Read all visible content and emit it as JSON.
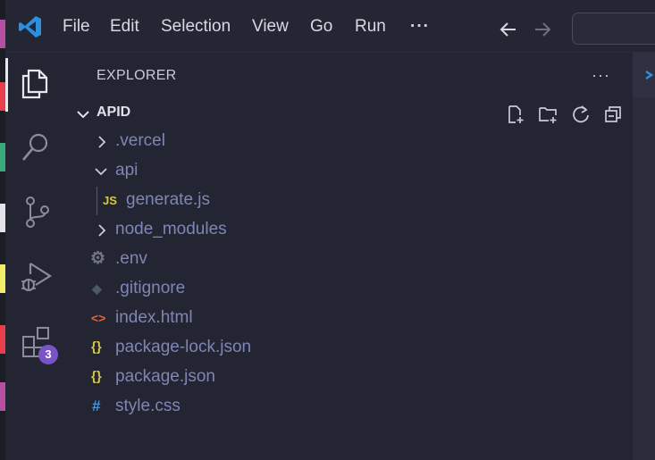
{
  "colors": {
    "background": "#242533",
    "accent_blue": "#2d8fe0",
    "tree_text": "#7f86b3",
    "badge": "#7b53c9",
    "html_icon": "#e0663a",
    "json_icon": "#d6c84b",
    "css_icon": "#4a93d6",
    "js_icon": "#d6c84b",
    "gear_icon": "#6f7486",
    "git_icon": "#4d5a66"
  },
  "left_strip_colors": [
    "#b64ea1",
    "#e8404a",
    "#3aa87a",
    "#e3e3e8",
    "#f2ee6a",
    "#e8404a",
    "#b64ea1"
  ],
  "menu": {
    "items": [
      "File",
      "Edit",
      "Selection",
      "View",
      "Go",
      "Run"
    ],
    "more": "···"
  },
  "activity_bar": {
    "items": [
      {
        "name": "explorer",
        "icon": "files-icon",
        "active": true
      },
      {
        "name": "search",
        "icon": "search-icon"
      },
      {
        "name": "source-control",
        "icon": "source-control-icon"
      },
      {
        "name": "run-and-debug",
        "icon": "debug-icon"
      },
      {
        "name": "extensions",
        "icon": "extensions-icon",
        "badge": "3"
      }
    ]
  },
  "explorer": {
    "title": "EXPLORER",
    "more": "···",
    "folder": "APID",
    "header_actions": [
      "new-file-icon",
      "new-folder-icon",
      "refresh-icon",
      "collapse-all-icon"
    ],
    "tree": [
      {
        "label": ".vercel",
        "type": "folder",
        "expanded": false,
        "depth": 0
      },
      {
        "label": "api",
        "type": "folder",
        "expanded": true,
        "depth": 0
      },
      {
        "label": "generate.js",
        "type": "file",
        "icon_text": "JS",
        "icon": "js-file-icon",
        "depth": 1
      },
      {
        "label": "node_modules",
        "type": "folder",
        "expanded": false,
        "depth": 0
      },
      {
        "label": ".env",
        "type": "file",
        "icon_text": "⚙",
        "icon": "env-gear-icon",
        "depth": 0
      },
      {
        "label": ".gitignore",
        "type": "file",
        "icon_text": "◆",
        "icon": "git-file-icon",
        "depth": 0
      },
      {
        "label": "index.html",
        "type": "file",
        "icon_text": "<>",
        "icon": "html-file-icon",
        "depth": 0
      },
      {
        "label": "package-lock.json",
        "type": "file",
        "icon_text": "{}",
        "icon": "json-file-icon",
        "depth": 0
      },
      {
        "label": "package.json",
        "type": "file",
        "icon_text": "{}",
        "icon": "json-file-icon",
        "depth": 0
      },
      {
        "label": "style.css",
        "type": "file",
        "icon_text": "#",
        "icon": "css-file-icon",
        "depth": 0
      }
    ]
  }
}
